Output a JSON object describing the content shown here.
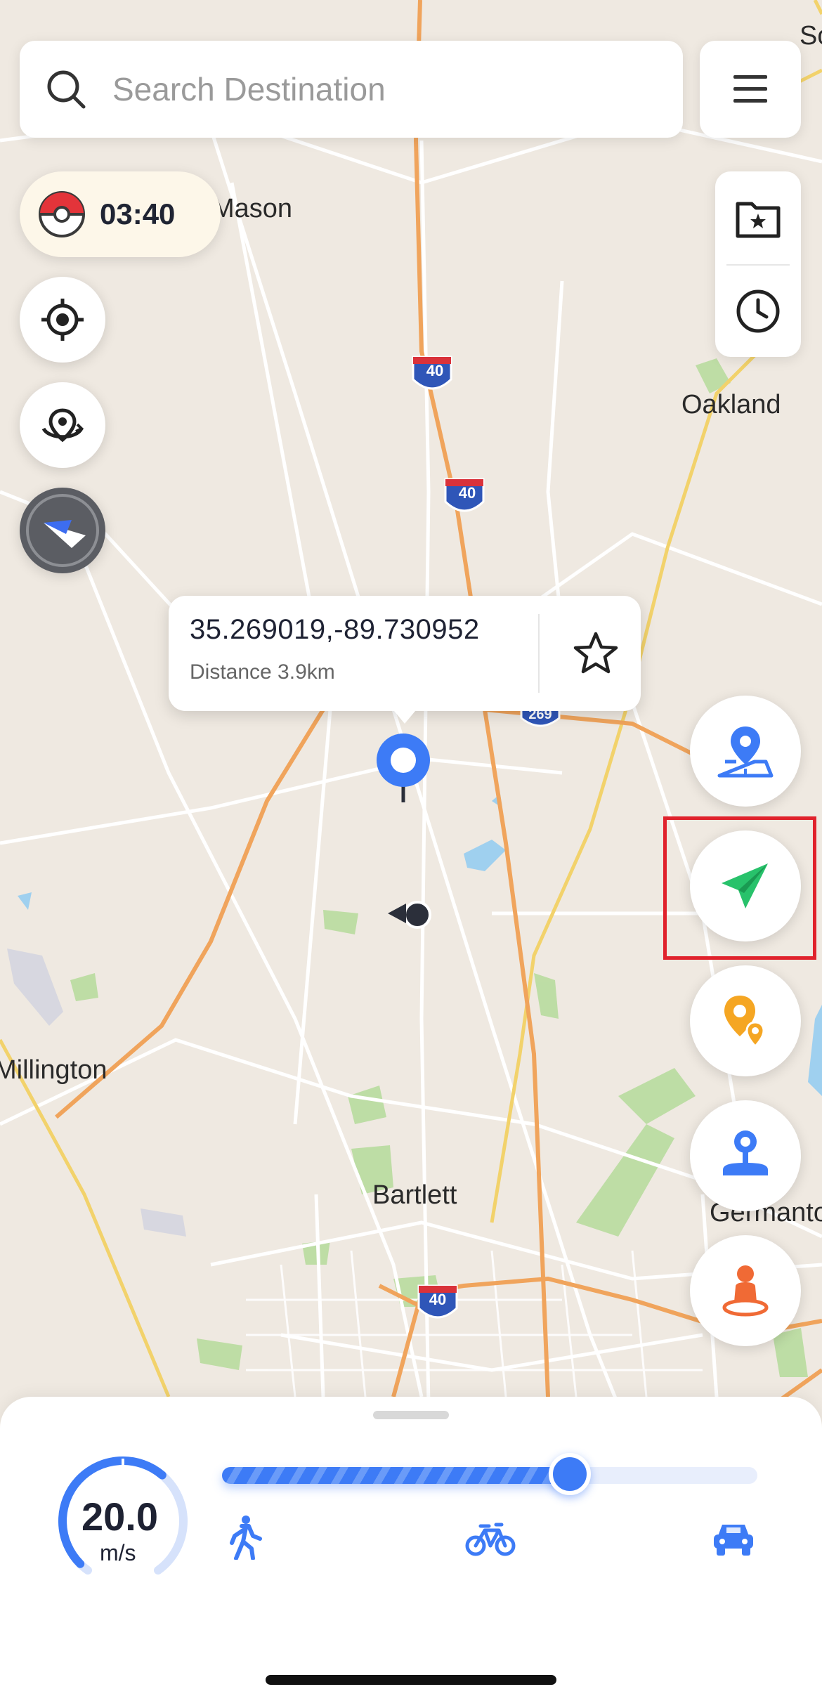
{
  "search": {
    "placeholder": "Search Destination"
  },
  "timer": {
    "value": "03:40"
  },
  "map_labels": {
    "mason": "Mason",
    "oakland": "Oakland",
    "millington": "Millington",
    "bartlett": "Bartlett",
    "germantown": "Germantown",
    "so": "So",
    "i40": "40",
    "i269": "269"
  },
  "popup": {
    "coordinates": "35.269019,-89.730952",
    "distance": "Distance 3.9km"
  },
  "speed": {
    "value": "20.0",
    "unit": "m/s",
    "slider_fraction": 0.65
  },
  "colors": {
    "accent_blue": "#3d7bf6",
    "green_send": "#28c26b",
    "orange_poi": "#f5a623",
    "highlight_red": "#e0222c",
    "interstate_orange": "#f0a45c"
  },
  "icons": [
    "search-icon",
    "menu-icon",
    "pokeball-icon",
    "locate-icon",
    "rotate-location-icon",
    "compass-icon",
    "folder-star-icon",
    "history-icon",
    "star-icon",
    "map-pin-icon",
    "teleport-icon",
    "send-icon",
    "multi-stop-icon",
    "joystick-icon",
    "avatar-icon",
    "walk-icon",
    "bike-icon",
    "car-icon"
  ]
}
